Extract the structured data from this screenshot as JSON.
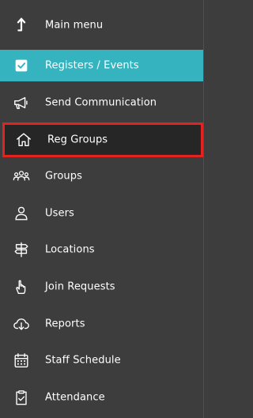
{
  "colors": {
    "sidebar_bg": "#3d3d3d",
    "active_bg": "#35b3bf",
    "selected_bg": "#262626",
    "highlight_border": "#e3231f",
    "text": "#ffffff"
  },
  "sidebar": {
    "items": [
      {
        "label": "Main menu",
        "icon": "arrow-up-icon"
      },
      {
        "label": "Registers / Events",
        "icon": "checkbox-icon",
        "state": "active"
      },
      {
        "label": "Send Communication",
        "icon": "megaphone-icon"
      },
      {
        "label": "Reg Groups",
        "icon": "home-icon",
        "state": "highlighted"
      },
      {
        "label": "Groups",
        "icon": "people-group-icon"
      },
      {
        "label": "Users",
        "icon": "user-icon"
      },
      {
        "label": "Locations",
        "icon": "signpost-icon"
      },
      {
        "label": "Join Requests",
        "icon": "hand-pointer-icon"
      },
      {
        "label": "Reports",
        "icon": "cloud-download-icon"
      },
      {
        "label": "Staff Schedule",
        "icon": "calendar-icon"
      },
      {
        "label": "Attendance",
        "icon": "clipboard-check-icon"
      }
    ]
  }
}
